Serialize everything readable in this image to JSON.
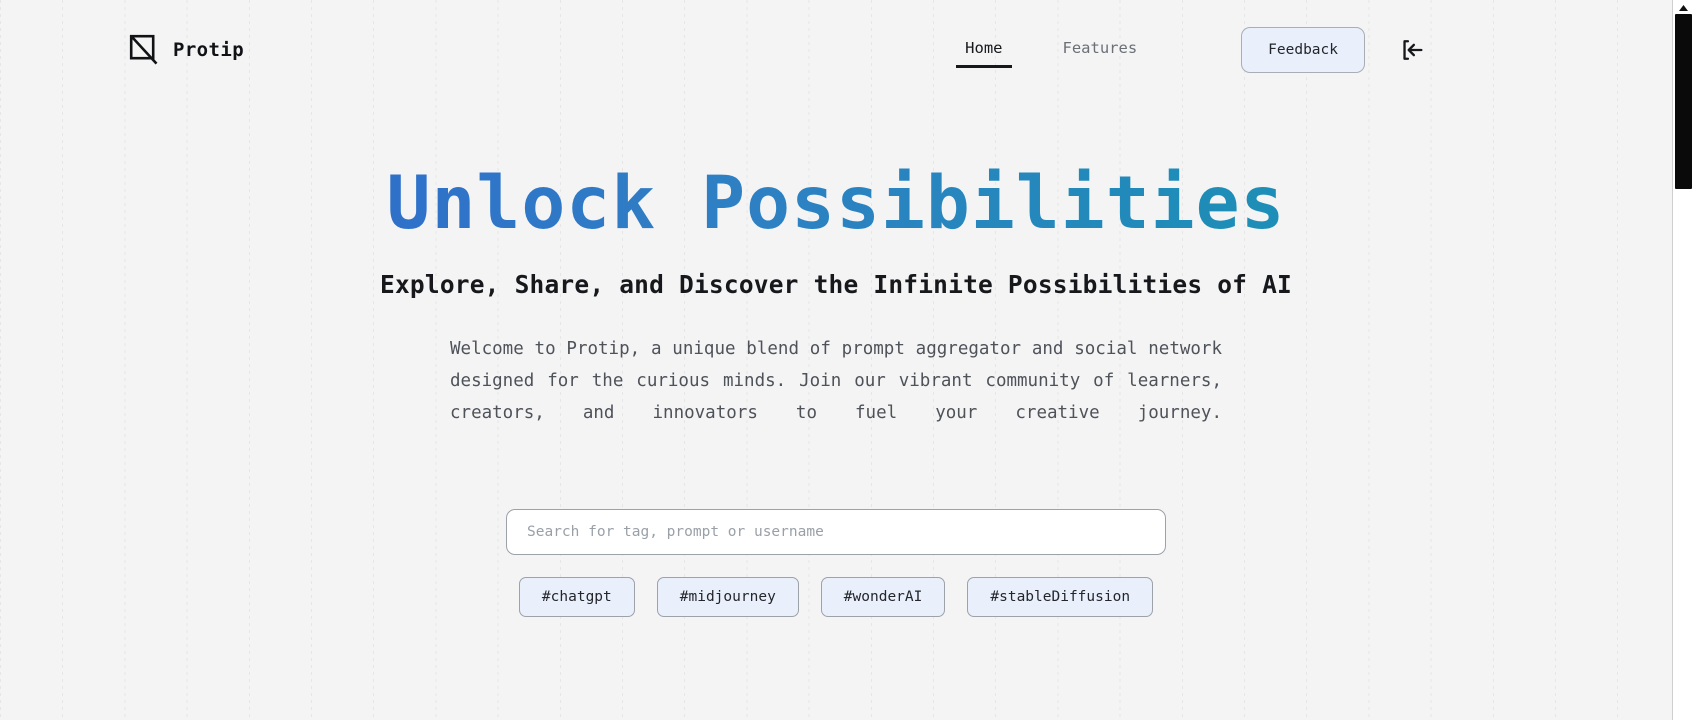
{
  "brand": {
    "name": "Protip",
    "logo_icon": "square-diagonal-logo-icon"
  },
  "nav": {
    "links": [
      {
        "label": "Home",
        "active": true
      },
      {
        "label": "Features",
        "active": false
      }
    ],
    "feedback_label": "Feedback",
    "login_icon": "arrow-left-to-bracket-icon"
  },
  "hero": {
    "headline": "Unlock Possibilities",
    "subheadline": "Explore, Share, and Discover the Infinite Possibilities of AI",
    "body": "Welcome to Protip, a unique blend of prompt aggregator and social network designed for the curious minds. Join our vibrant community of learners, creators, and innovators to fuel your creative journey."
  },
  "search": {
    "placeholder": "Search for tag, prompt or username",
    "value": ""
  },
  "tags": [
    {
      "label": "#chatgpt"
    },
    {
      "label": "#midjourney"
    },
    {
      "label": "#wonderAI"
    },
    {
      "label": "#stableDiffusion"
    }
  ],
  "colors": {
    "page_bg": "#f4f4f5",
    "headline_gradient_start": "#2f5fd0",
    "headline_gradient_end": "#1a93b8",
    "accent_chip_bg": "#eaf0fb",
    "text_primary": "#16181c",
    "text_muted": "#6b7077"
  }
}
